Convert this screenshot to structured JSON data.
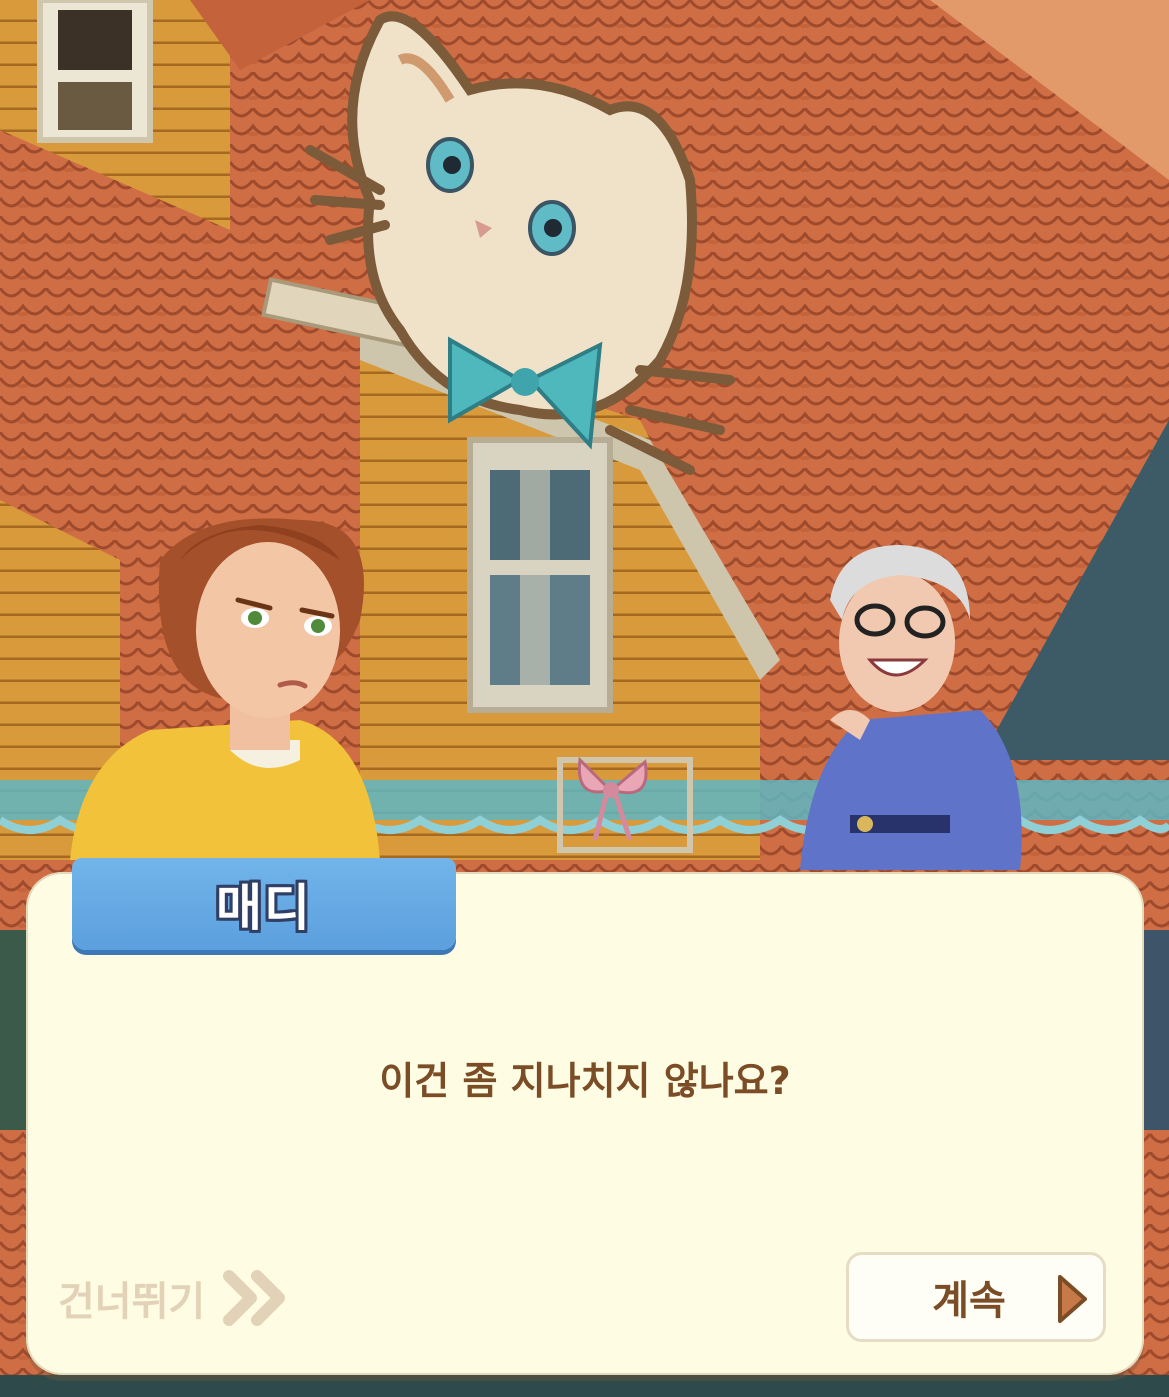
{
  "dialog": {
    "speaker_name": "매디",
    "line": "이건 좀 지나치지 않나요?"
  },
  "controls": {
    "skip_label": "건너뛰기",
    "continue_label": "계속"
  },
  "icons": {
    "skip": "double-chevron-right-icon",
    "continue": "play-triangle-icon"
  },
  "colors": {
    "name_tag": "#5fa3e2",
    "dialog_bg": "#fefce3",
    "dialog_text": "#7a4d26",
    "skip_text": "#e2d3b8"
  }
}
